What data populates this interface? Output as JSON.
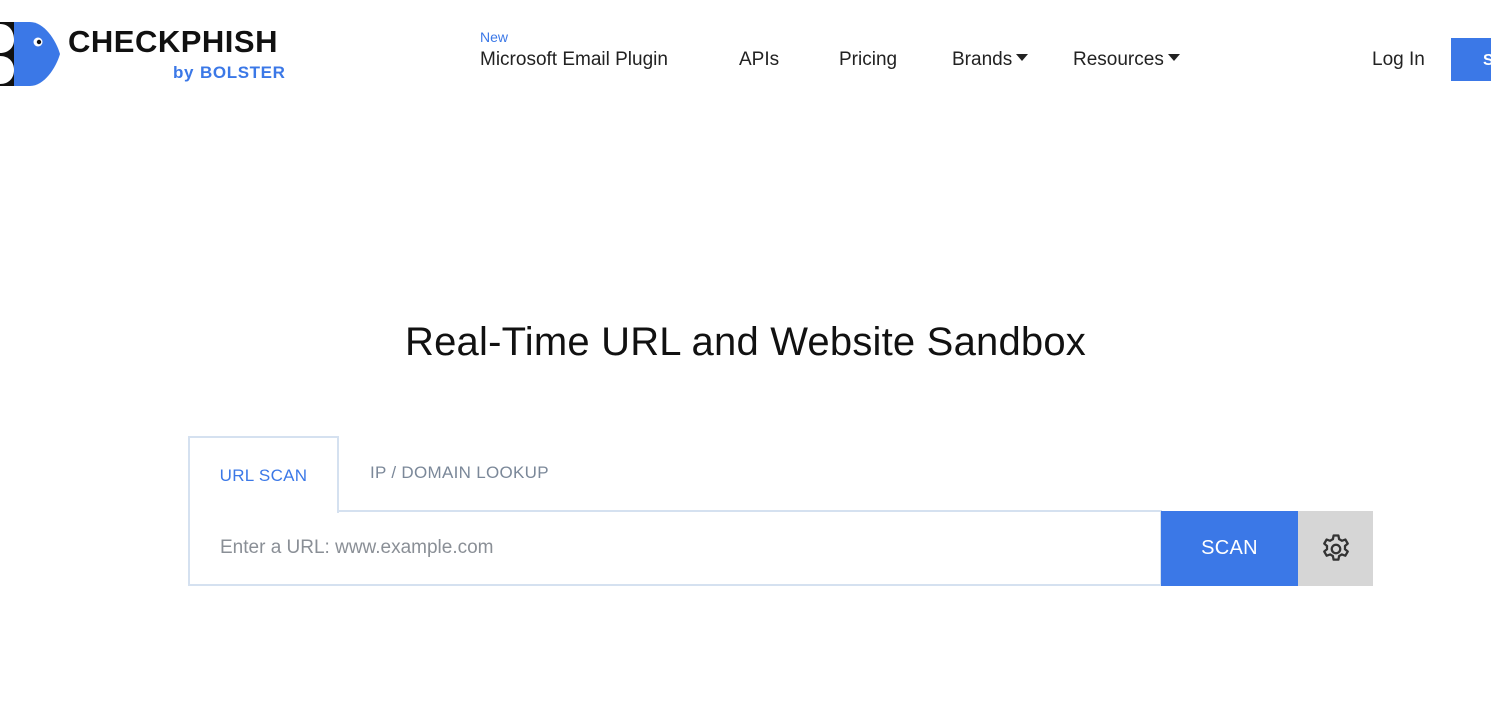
{
  "brand": {
    "name": "CHECKPHISH",
    "by": "by",
    "sub": "BOLSTER",
    "accent_color": "#3b78e7"
  },
  "nav": {
    "new_badge": "New",
    "items": [
      {
        "label": "Microsoft Email Plugin"
      },
      {
        "label": "APIs"
      },
      {
        "label": "Pricing"
      },
      {
        "label": "Brands",
        "dropdown": true
      },
      {
        "label": "Resources",
        "dropdown": true
      }
    ],
    "login": "Log In",
    "signup_partial": "S"
  },
  "hero": {
    "title": "Real-Time URL and Website Sandbox"
  },
  "tabs": [
    {
      "label": "URL SCAN",
      "active": true
    },
    {
      "label": "IP / DOMAIN LOOKUP",
      "active": false
    }
  ],
  "scan": {
    "placeholder": "Enter a URL: www.example.com",
    "value": "",
    "button_label": "SCAN",
    "settings_icon": "gear-icon"
  }
}
